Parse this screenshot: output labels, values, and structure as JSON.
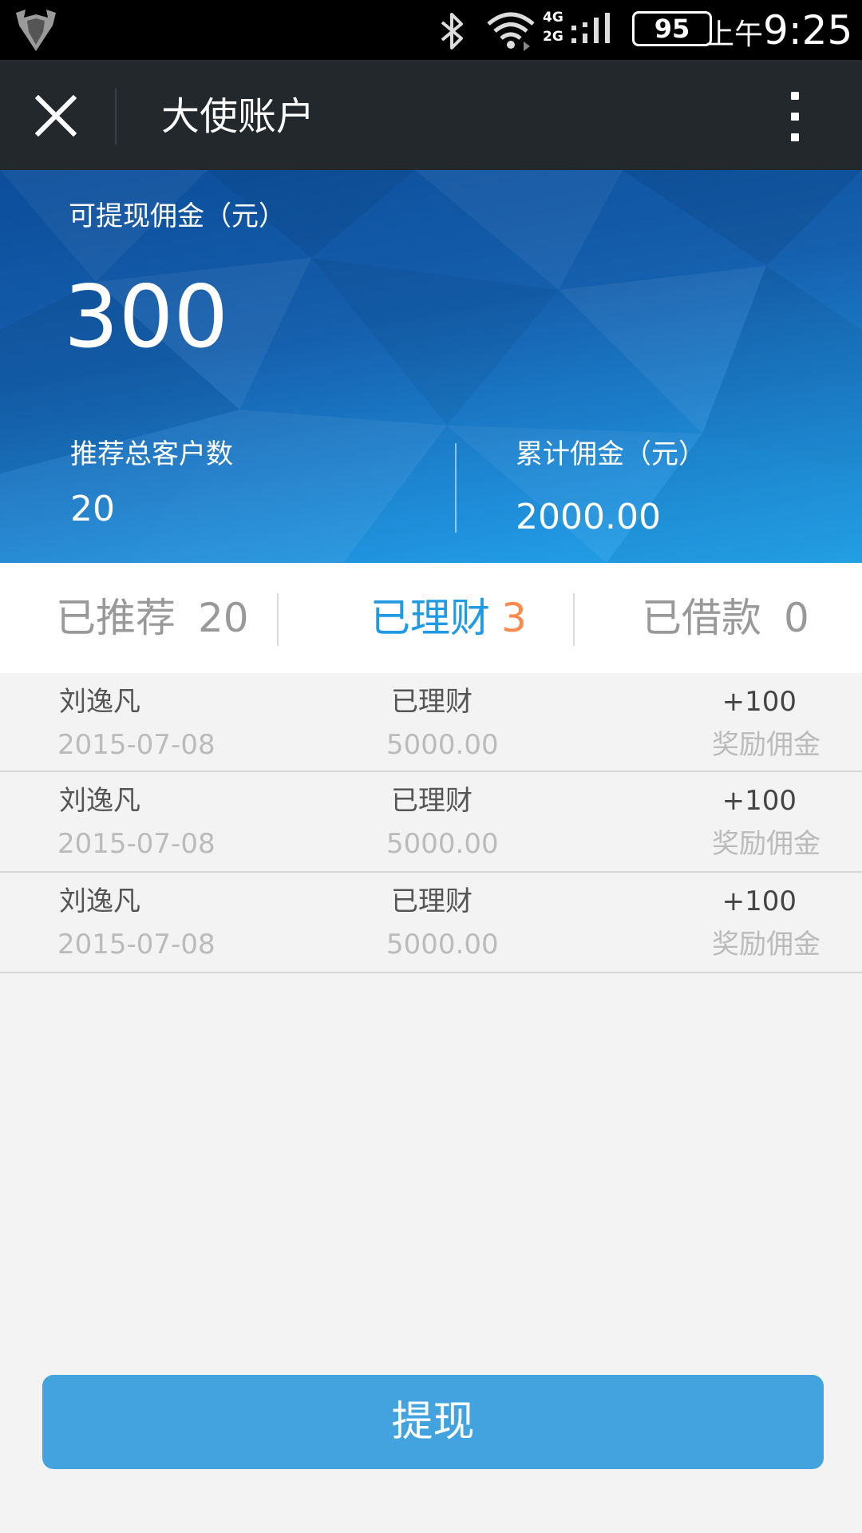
{
  "status_bar": {
    "network_4g": "4G",
    "network_2g": "2G",
    "battery": "95",
    "time_prefix": "上午",
    "time": "9:25"
  },
  "title_bar": {
    "title": "大使账户",
    "icons": [
      "close-icon",
      "more-icon"
    ]
  },
  "hero": {
    "withdrawable_label": "可提现佣金（元）",
    "withdrawable_value": "300",
    "total_customers_label": "推荐总客户数",
    "total_customers_value": "20",
    "cumulative_label": "累计佣金（元）",
    "cumulative_value": "2000.00"
  },
  "tabs": [
    {
      "label": "已推荐",
      "count": "20"
    },
    {
      "label": "已理财",
      "count": "3"
    },
    {
      "label": "已借款",
      "count": "0"
    }
  ],
  "colors": {
    "active_tab": "#1f9ae3",
    "active_count": "#ff8a4e",
    "button": "#42a3df",
    "titlebar": "#22282c"
  },
  "records": [
    {
      "name": "刘逸凡",
      "date": "2015-07-08",
      "status": "已理财",
      "amount": "5000.00",
      "commission": "+100",
      "commission_label": "奖励佣金"
    },
    {
      "name": "刘逸凡",
      "date": "2015-07-08",
      "status": "已理财",
      "amount": "5000.00",
      "commission": "+100",
      "commission_label": "奖励佣金"
    },
    {
      "name": "刘逸凡",
      "date": "2015-07-08",
      "status": "已理财",
      "amount": "5000.00",
      "commission": "+100",
      "commission_label": "奖励佣金"
    }
  ],
  "withdraw_button": "提现"
}
